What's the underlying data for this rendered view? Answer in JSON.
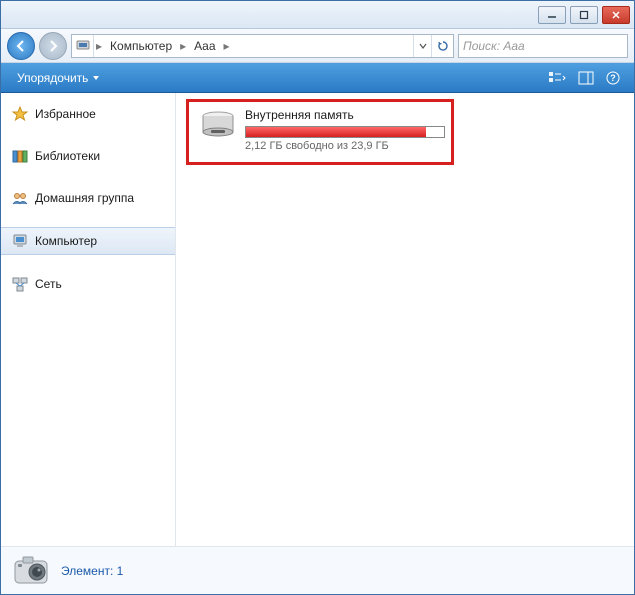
{
  "titlebar": {
    "min": "–",
    "max": "❐",
    "close": "✕"
  },
  "navbar": {
    "breadcrumb": {
      "seg1": "Компьютер",
      "seg2": "Aaa"
    },
    "search_placeholder": "Поиск: Aaa"
  },
  "toolbar": {
    "organize": "Упорядочить"
  },
  "sidebar": {
    "favorites": "Избранное",
    "libraries": "Библиотеки",
    "homegroup": "Домашняя группа",
    "computer": "Компьютер",
    "network": "Сеть"
  },
  "drive": {
    "name": "Внутренняя память",
    "free_text": "2,12 ГБ свободно из 23,9 ГБ",
    "fill_percent": 91
  },
  "status": {
    "text": "Элемент: 1"
  }
}
